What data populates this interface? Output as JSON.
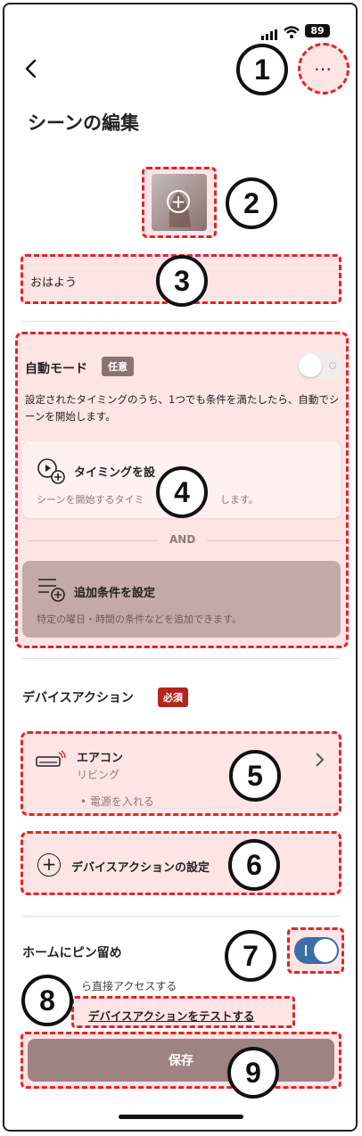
{
  "status": {
    "battery": "89"
  },
  "header": {
    "title": "シーンの編集"
  },
  "scene": {
    "name": "おはよう"
  },
  "auto_mode": {
    "title": "自動モード",
    "badge": "任意",
    "description": "設定されたタイミングのうち、1つでも条件を満たしたら、自動でシーンを開始します。",
    "timing_title": "タイミングを設",
    "timing_sub": "シーンを開始するタイミ",
    "timing_sub_tail": "します。",
    "and_label": "AND",
    "condition_title": "追加条件を設定",
    "condition_sub": "特定の曜日・時間の条件などを追加できます。"
  },
  "device_action": {
    "title": "デバイスアクション",
    "badge": "必須",
    "device_name": "エアコン",
    "device_room": "リビング",
    "device_action": "• 電源を入れる",
    "add_label": "デバイスアクションの設定"
  },
  "pin": {
    "title": "ホームにピン留め",
    "sub": "ら直接アクセスする"
  },
  "test_link": "デバイスアクションをテストする",
  "save_label": "保存",
  "annotations": [
    "1",
    "2",
    "3",
    "4",
    "5",
    "6",
    "7",
    "8",
    "9"
  ],
  "colors": {
    "accent_red": "#e0242b",
    "toggle_blue": "#3a6ea8",
    "save_bg": "#9e8384",
    "badge_required": "#b3261e"
  }
}
